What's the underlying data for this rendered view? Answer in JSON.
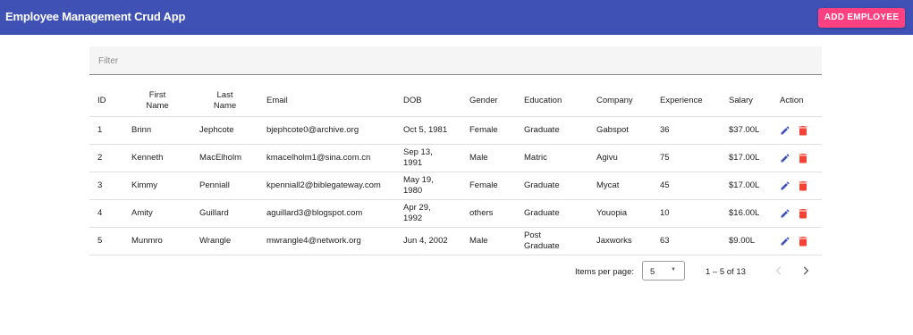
{
  "app": {
    "title": "Employee Management Crud App",
    "add_button_label": "ADD EMPLOYEE",
    "brand_color": "#3f51b5",
    "accent_color": "#ff4081"
  },
  "filter": {
    "placeholder": "Filter",
    "value": ""
  },
  "table": {
    "headers": {
      "id": "ID",
      "first_name_1": "First",
      "first_name_2": "Name",
      "last_name_1": "Last",
      "last_name_2": "Name",
      "email": "Email",
      "dob": "DOB",
      "gender": "Gender",
      "education": "Education",
      "company": "Company",
      "experience": "Experience",
      "salary": "Salary",
      "action": "Action"
    },
    "rows": [
      {
        "id": "1",
        "first": "Brinn",
        "last": "Jephcote",
        "email": "bjephcote0@archive.org",
        "dob_1": "Oct 5, 1981",
        "dob_2": "",
        "gender": "Female",
        "education_1": "Graduate",
        "education_2": "",
        "company": "Gabspot",
        "experience": "36",
        "salary": "$37.00L"
      },
      {
        "id": "2",
        "first": "Kenneth",
        "last": "MacElholm",
        "email": "kmacelholm1@sina.com.cn",
        "dob_1": "Sep 13,",
        "dob_2": "1991",
        "gender": "Male",
        "education_1": "Matric",
        "education_2": "",
        "company": "Agivu",
        "experience": "75",
        "salary": "$17.00L"
      },
      {
        "id": "3",
        "first": "Kimmy",
        "last": "Penniall",
        "email": "kpenniall2@biblegateway.com",
        "dob_1": "May 19,",
        "dob_2": "1980",
        "gender": "Female",
        "education_1": "Graduate",
        "education_2": "",
        "company": "Mycat",
        "experience": "45",
        "salary": "$17.00L"
      },
      {
        "id": "4",
        "first": "Amity",
        "last": "Guillard",
        "email": "aguillard3@blogspot.com",
        "dob_1": "Apr 29,",
        "dob_2": "1992",
        "gender": "others",
        "education_1": "Graduate",
        "education_2": "",
        "company": "Youopia",
        "experience": "10",
        "salary": "$16.00L"
      },
      {
        "id": "5",
        "first": "Munmro",
        "last": "Wrangle",
        "email": "mwrangle4@network.org",
        "dob_1": "Jun 4, 2002",
        "dob_2": "",
        "gender": "Male",
        "education_1": "Post",
        "education_2": "Graduate",
        "company": "Jaxworks",
        "experience": "63",
        "salary": "$9.00L"
      }
    ],
    "icons": {
      "edit": "edit-icon",
      "delete": "delete-icon",
      "edit_color": "#3f51b5",
      "delete_color": "#f44336"
    }
  },
  "paginator": {
    "items_per_page_label": "Items per page:",
    "items_per_page_value": "5",
    "range_label": "1 – 5 of 13"
  }
}
